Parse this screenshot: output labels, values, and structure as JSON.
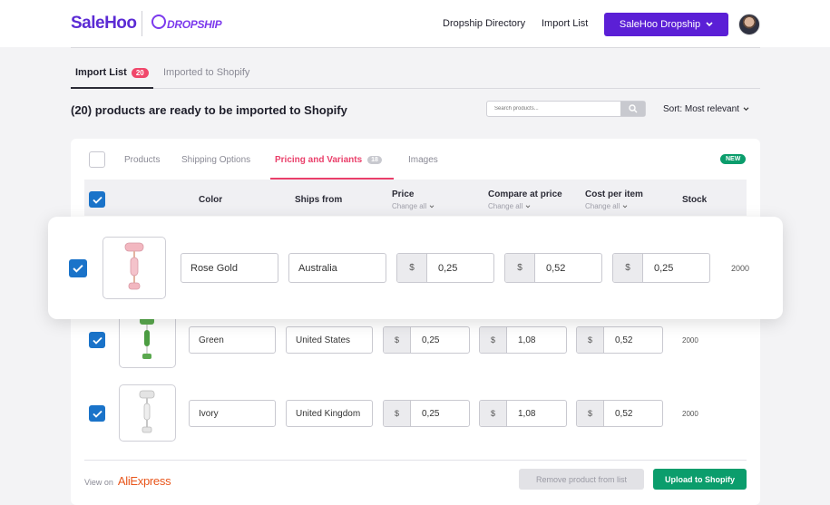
{
  "brand": {
    "salehoo": "SaleHoo",
    "dropship": "DROPSHIP"
  },
  "nav": {
    "directory": "Dropship Directory",
    "import_list": "Import List",
    "dropship_button": "SaleHoo Dropship"
  },
  "tabs": {
    "import_list": "Import List",
    "import_count": "20",
    "imported": "Imported to Shopify"
  },
  "page": {
    "title": "(20) products are ready to be imported to Shopify"
  },
  "search": {
    "placeholder": "Search products..."
  },
  "sort": {
    "label": "Sort: Most relevant"
  },
  "card_tabs": {
    "products": "Products",
    "shipping": "Shipping Options",
    "pricing": "Pricing and Variants",
    "pricing_count": "18",
    "images": "Images",
    "new_badge": "NEW"
  },
  "columns": {
    "color": "Color",
    "ships_from": "Ships from",
    "price": "Price",
    "compare": "Compare at price",
    "cost": "Cost per item",
    "stock": "Stock",
    "change_all": "Change all"
  },
  "currency": "$",
  "rows": [
    {
      "color": "Rose Gold",
      "ships_from": "Australia",
      "price": "0,25",
      "compare": "0,52",
      "cost": "0,25",
      "stock": "2000"
    },
    {
      "color": "Green",
      "ships_from": "United States",
      "price": "0,25",
      "compare": "1,08",
      "cost": "0,52",
      "stock": "2000"
    },
    {
      "color": "Ivory",
      "ships_from": "United Kingdom",
      "price": "0,25",
      "compare": "1,08",
      "cost": "0,52",
      "stock": "2000"
    }
  ],
  "footer": {
    "view_on": "View on",
    "aliexpress": "AliExpress",
    "remove": "Remove product from list",
    "upload": "Upload to Shopify"
  },
  "colors": {
    "brand_purple": "#5b1fd6",
    "accent_pink": "#ea3f6a",
    "checkbox_blue": "#1a73c9",
    "success_green": "#0b9d6c"
  },
  "icons": {
    "checkbox": "check-icon",
    "search": "search-icon",
    "chevron": "chevron-down-icon"
  }
}
